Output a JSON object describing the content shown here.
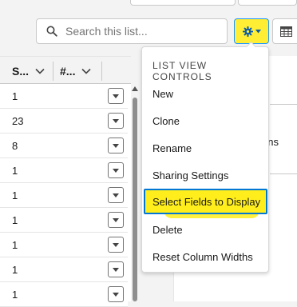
{
  "search": {
    "placeholder": "Search this list..."
  },
  "toolbar": {
    "settings_icon": "gear-icon",
    "display_icon": "table-icon"
  },
  "columns": [
    {
      "label": "S..."
    },
    {
      "label": "#..."
    }
  ],
  "rows": [
    "1",
    "23",
    "8",
    "1",
    "1",
    "1",
    "1",
    "1",
    "1"
  ],
  "menu": {
    "title": "LIST VIEW CONTROLS",
    "items": [
      "New",
      "Clone",
      "Rename",
      "Sharing Settings",
      "Select Fields to Display",
      "Delete",
      "Reset Column Widths"
    ]
  },
  "right_panel": {
    "partial_text": "ons"
  },
  "colors": {
    "highlight": "#ffee1c",
    "focus": "#0176d3"
  }
}
